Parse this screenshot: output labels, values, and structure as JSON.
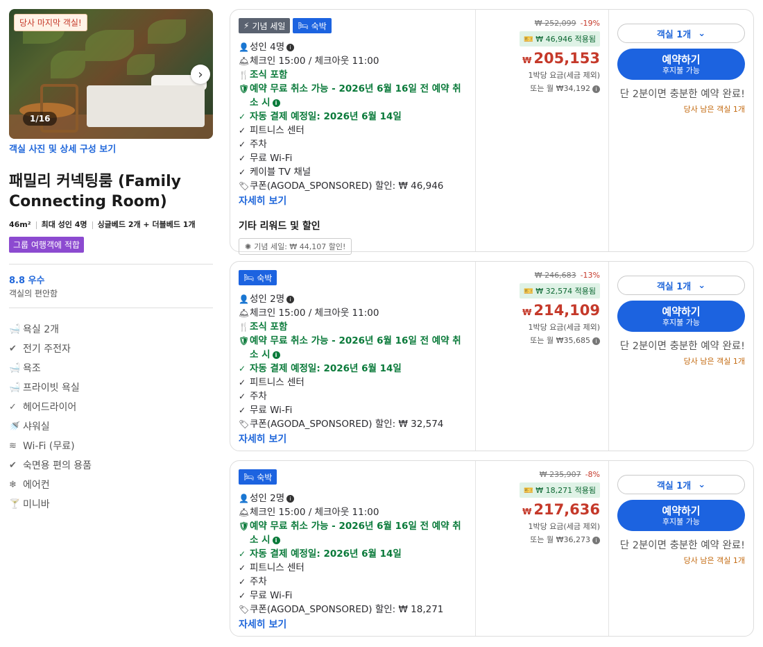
{
  "room": {
    "last_room_tag": "당사 마지막 객실!",
    "photo_count": "1/16",
    "photos_link": "객실 사진 및 상세 구성 보기",
    "title": "패밀리 커넥팅룸 (Family Connecting Room)",
    "size": "46m²",
    "max_occupancy": "최대 성인 4명",
    "beds": "싱글베드 2개 + 더블베드 1개",
    "group_badge": "그룹 여행객에 적합",
    "rating_score": "8.8 우수",
    "rating_label": "객실의 편안함",
    "amenities": [
      {
        "icon": "bathtub-icon",
        "glyph": "🛁",
        "label": "욕실 2개"
      },
      {
        "icon": "check-circle-icon",
        "glyph": "✔",
        "label": "전기 주전자"
      },
      {
        "icon": "bathtub-icon",
        "glyph": "🛁",
        "label": "욕조"
      },
      {
        "icon": "bathtub-icon",
        "glyph": "🛁",
        "label": "프라이빗 욕실"
      },
      {
        "icon": "check-icon",
        "glyph": "✓",
        "label": "헤어드라이어"
      },
      {
        "icon": "shower-icon",
        "glyph": "🚿",
        "label": "샤워실"
      },
      {
        "icon": "wifi-icon",
        "glyph": "≋",
        "label": "Wi-Fi (무료)"
      },
      {
        "icon": "check-circle-icon",
        "glyph": "✔",
        "label": "숙면용 편의 용품"
      },
      {
        "icon": "snowflake-icon",
        "glyph": "❄",
        "label": "에어컨"
      },
      {
        "icon": "cocktail-icon",
        "glyph": "🍸",
        "label": "미니바"
      }
    ]
  },
  "offers": [
    {
      "tags": [
        {
          "label": "기념 세일",
          "icon": "⚡",
          "style": "gray"
        },
        {
          "label": "숙박",
          "icon": "🛏",
          "style": "blue"
        }
      ],
      "occupancy": "성인 4명",
      "checkin": "체크인 15:00 / 체크아웃 11:00",
      "breakfast": "조식 포함",
      "free_cancel": "예약 무료 취소 가능 - 2026년 6월 16일 전 예약 취소 시",
      "auto_payment": "자동 결제 예정일: 2026년 6월 14일",
      "features": [
        "피트니스 센터",
        "주차",
        "무료 Wi-Fi",
        "케이블 TV 채널"
      ],
      "coupon": "쿠폰(AGODA_SPONSORED) 할인: ₩ 46,946",
      "more_link": "자세히 보기",
      "extra_title": "기타 리워드 및 할인",
      "extra_chip": "기념 세일: ₩ 44,107 할인!",
      "original_price": "₩ 252,099",
      "discount_pct": "-19%",
      "coupon_applied": "₩ 46,946 적용됨",
      "currency": "₩",
      "price": "205,153",
      "per_night": "1박당 요금(세금 제외)",
      "monthly": "또는 월 ₩34,192",
      "room_select": "객실 1개",
      "book_label": "예약하기",
      "book_sub": "후지불 가능",
      "urgency": "단 2분이면 충분한 예약 완료!",
      "remaining": "당사 남은 객실 1개"
    },
    {
      "tags": [
        {
          "label": "숙박",
          "icon": "🛏",
          "style": "blue"
        }
      ],
      "occupancy": "성인 2명",
      "checkin": "체크인 15:00 / 체크아웃 11:00",
      "breakfast": "조식 포함",
      "free_cancel": "예약 무료 취소 가능 - 2026년 6월 16일 전 예약 취소 시",
      "auto_payment": "자동 결제 예정일: 2026년 6월 14일",
      "features": [
        "피트니스 센터",
        "주차",
        "무료 Wi-Fi"
      ],
      "coupon": "쿠폰(AGODA_SPONSORED) 할인: ₩ 32,574",
      "more_link": "자세히 보기",
      "original_price": "₩ 246,683",
      "discount_pct": "-13%",
      "coupon_applied": "₩ 32,574 적용됨",
      "currency": "₩",
      "price": "214,109",
      "per_night": "1박당 요금(세금 제외)",
      "monthly": "또는 월 ₩35,685",
      "room_select": "객실 1개",
      "book_label": "예약하기",
      "book_sub": "후지불 가능",
      "urgency": "단 2분이면 충분한 예약 완료!",
      "remaining": "당사 남은 객실 1개"
    },
    {
      "tags": [
        {
          "label": "숙박",
          "icon": "🛏",
          "style": "blue"
        }
      ],
      "occupancy": "성인 2명",
      "checkin": "체크인 15:00 / 체크아웃 11:00",
      "free_cancel": "예약 무료 취소 가능 - 2026년 6월 16일 전 예약 취소 시",
      "auto_payment": "자동 결제 예정일: 2026년 6월 14일",
      "features": [
        "피트니스 센터",
        "주차",
        "무료 Wi-Fi"
      ],
      "coupon": "쿠폰(AGODA_SPONSORED) 할인: ₩ 18,271",
      "more_link": "자세히 보기",
      "original_price": "₩ 235,907",
      "discount_pct": "-8%",
      "coupon_applied": "₩ 18,271 적용됨",
      "currency": "₩",
      "price": "217,636",
      "per_night": "1박당 요금(세금 제외)",
      "monthly": "또는 월 ₩36,273",
      "room_select": "객실 1개",
      "book_label": "예약하기",
      "book_sub": "후지불 가능",
      "urgency": "단 2분이면 충분한 예약 완료!",
      "remaining": "당사 남은 객실 1개"
    }
  ]
}
